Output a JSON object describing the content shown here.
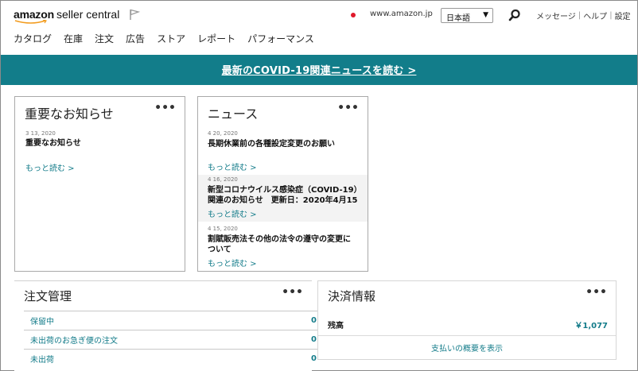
{
  "header": {
    "logo_amazon": "amazon",
    "logo_product": "seller central",
    "marketplace": "www.amazon.jp",
    "language": "日本語",
    "links": [
      "メッセージ",
      "ヘルプ",
      "設定"
    ],
    "nav": [
      "カタログ",
      "在庫",
      "注文",
      "広告",
      "ストア",
      "レポート",
      "パフォーマンス"
    ]
  },
  "banner": {
    "text": "最新のCOVID-19関連ニュースを読む >"
  },
  "notices": {
    "title": "重要なお知らせ",
    "menu": "•••",
    "item": {
      "date": "3 13, 2020",
      "title": "重要なお知らせ",
      "more": "もっと読む >"
    }
  },
  "news": {
    "title": "ニュース",
    "menu": "•••",
    "items": [
      {
        "date": "4 20, 2020",
        "title": "長期休業前の各種設定変更のお願い",
        "more": "もっと読む >"
      },
      {
        "date": "4 16, 2020",
        "title_line1": "新型コロナウイルス感染症（COVID-19）",
        "title_line2": "関連のお知らせ　更新日：2020年4月15",
        "more": "もっと読む >"
      },
      {
        "date": "4 15, 2020",
        "title_line1": "割賦販売法その他の法令の遵守の変更に",
        "title_line2": "ついて",
        "more": "もっと読む >"
      }
    ]
  },
  "orders": {
    "title": "注文管理",
    "menu": "•••",
    "rows": [
      {
        "label": "保留中",
        "count": "0"
      },
      {
        "label": "未出荷のお急ぎ便の注文",
        "count": "0"
      },
      {
        "label": "未出荷",
        "count": "0"
      }
    ]
  },
  "payments": {
    "title": "決済情報",
    "menu": "•••",
    "balance_label": "残高",
    "balance_value": "￥1,077",
    "summary_link": "支払いの概要を表示"
  },
  "colors": {
    "banner": "#127d8a",
    "link": "#147c8a"
  }
}
